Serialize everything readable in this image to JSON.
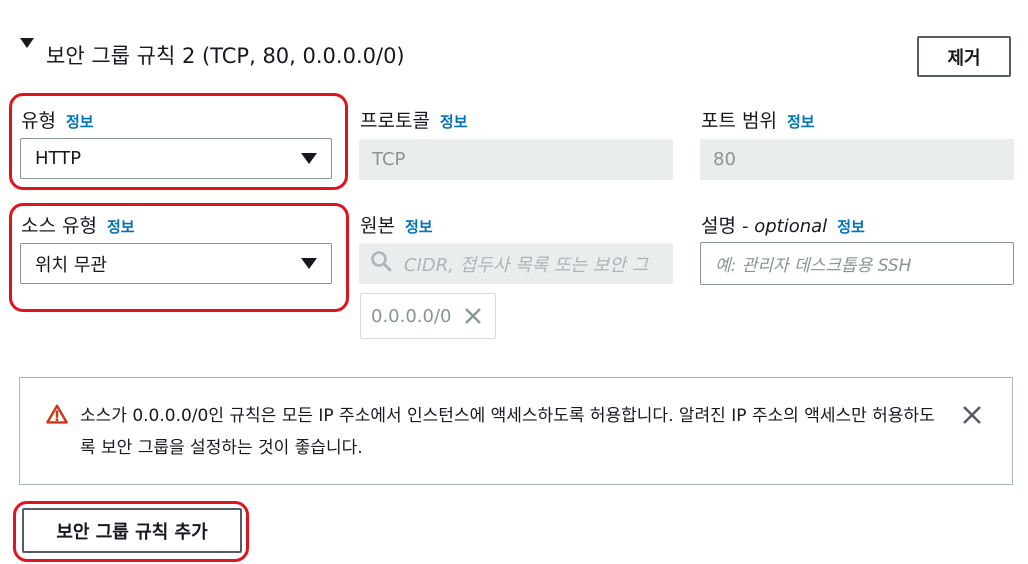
{
  "rule": {
    "title": "보안 그룹 규칙 2 (TCP, 80, 0.0.0.0/0)",
    "remove_label": "제거"
  },
  "info_label": "정보",
  "fields": {
    "type": {
      "label": "유형",
      "value": "HTTP"
    },
    "protocol": {
      "label": "프로토콜",
      "value": "TCP"
    },
    "port_range": {
      "label": "포트 범위",
      "value": "80"
    },
    "source_type": {
      "label": "소스 유형",
      "value": "위치 무관"
    },
    "source": {
      "label": "원본",
      "placeholder": "CIDR, 접두사 목록 또는 보안 그",
      "token": "0.0.0.0/0"
    },
    "description": {
      "label": "설명",
      "optional": "- optional",
      "placeholder": "예: 관리자 데스크톱용 SSH"
    }
  },
  "warning": {
    "text": "소스가 0.0.0.0/0인 규칙은 모든 IP 주소에서 인스턴스에 액세스하도록 허용합니다. 알려진 IP 주소의 액세스만 허용하도록 보안 그룹을 설정하는 것이 좋습니다."
  },
  "add_rule_label": "보안 그룹 규칙 추가",
  "icons": {
    "collapse": "caret-down-icon",
    "dropdown": "triangle-down-icon",
    "search": "search-icon",
    "remove_token": "close-icon",
    "warning": "warning-triangle-icon",
    "dismiss": "close-icon"
  },
  "colors": {
    "link": "#0073bb",
    "warning": "#d13212",
    "highlight": "#e0141e",
    "disabled_bg": "#eaeded"
  }
}
